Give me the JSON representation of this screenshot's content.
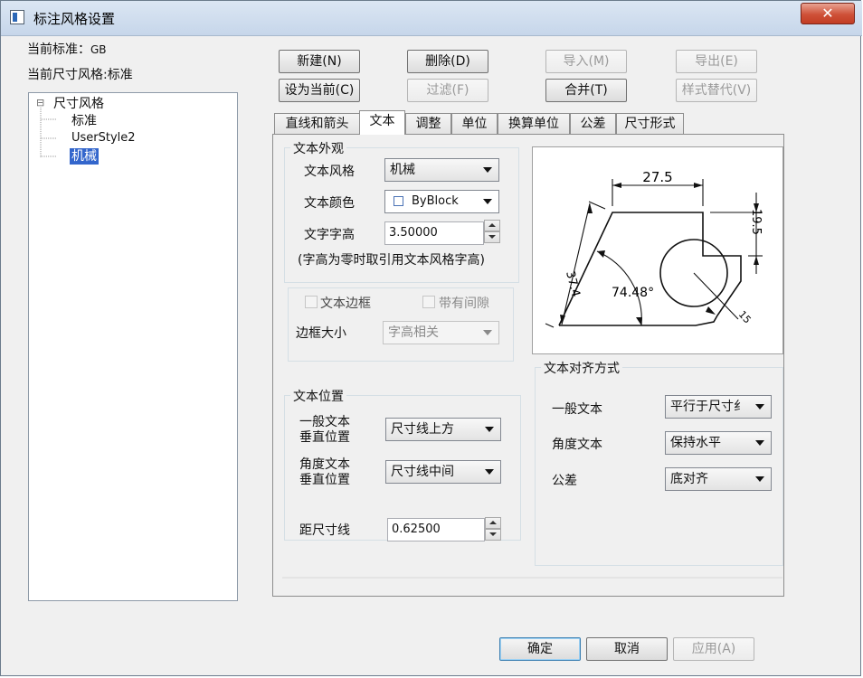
{
  "window": {
    "title": "标注风格设置",
    "close_symbol": "✕"
  },
  "header": {
    "current_standard_label": "当前标准：",
    "current_standard_value": "GB",
    "current_style_label": "当前尺寸风格:",
    "current_style_value": "标准"
  },
  "tree": {
    "root_toggle": "⊟",
    "root_label": "尺寸风格",
    "items": [
      {
        "label": "标准",
        "selected": false
      },
      {
        "label": "UserStyle2",
        "selected": false
      },
      {
        "label": "机械",
        "selected": true
      }
    ]
  },
  "buttons": {
    "new": "新建(N)",
    "delete": "删除(D)",
    "import": "导入(M)",
    "export": "导出(E)",
    "set_current": "设为当前(C)",
    "filter": "过滤(F)",
    "merge": "合并(T)",
    "style_replace": "样式替代(V)"
  },
  "tabs": [
    {
      "label": "直线和箭头",
      "active": false
    },
    {
      "label": "文本",
      "active": true
    },
    {
      "label": "调整",
      "active": false
    },
    {
      "label": "单位",
      "active": false
    },
    {
      "label": "换算单位",
      "active": false
    },
    {
      "label": "公差",
      "active": false
    },
    {
      "label": "尺寸形式",
      "active": false
    }
  ],
  "text_appearance": {
    "group_title": "文本外观",
    "style_label": "文本风格",
    "style_value": "机械",
    "color_label": "文本颜色",
    "color_value": "ByBlock",
    "height_label": "文字字高",
    "height_value": "3.50000",
    "height_note": "(字高为零时取引用文本风格字高)",
    "frame_label": "文本边框",
    "frame_checked": false,
    "gap_label": "带有间隙",
    "gap_checked": false,
    "frame_size_label": "边框大小",
    "frame_size_value": "字高相关"
  },
  "text_position": {
    "group_title": "文本位置",
    "general_label_1": "一般文本",
    "general_label_2": "垂直位置",
    "general_value": "尺寸线上方",
    "angle_label_1": "角度文本",
    "angle_label_2": "垂直位置",
    "angle_value": "尺寸线中间",
    "offset_label": "距尺寸线",
    "offset_value": "0.62500"
  },
  "text_alignment": {
    "group_title": "文本对齐方式",
    "general_label": "一般文本",
    "general_value": "平行于尺寸纟",
    "angle_label": "角度文本",
    "angle_value": "保持水平",
    "tolerance_label": "公差",
    "tolerance_value": "底对齐"
  },
  "preview": {
    "dim_top": "27.5",
    "dim_right": "19.5",
    "dim_left": "37.4",
    "dim_angle": "74.48°",
    "dim_radius": "15"
  },
  "footer": {
    "ok": "确定",
    "cancel": "取消",
    "apply": "应用(A)"
  },
  "colors": {
    "titlebar": "#c6d6ea",
    "close_button": "#cf5138",
    "selection": "#3366cc",
    "dialog_bg": "#f0f0f0"
  }
}
